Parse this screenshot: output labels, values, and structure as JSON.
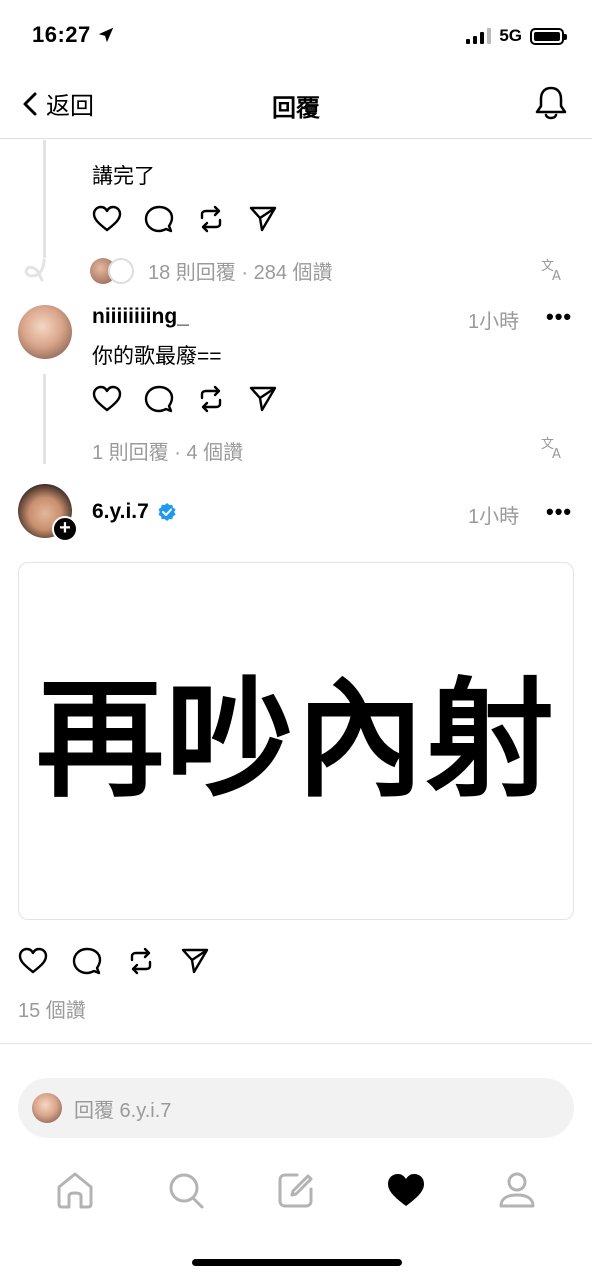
{
  "status_bar": {
    "time": "16:27",
    "network": "5G"
  },
  "header": {
    "back_label": "返回",
    "title": "回覆"
  },
  "parent_post": {
    "text": "講完了",
    "stats": "18 則回覆 · 284 個讚"
  },
  "reply": {
    "username": "niiiiiiiing_",
    "time": "1小時",
    "more": "•••",
    "text": "你的歌最廢==",
    "stats": "1 則回覆 · 4 個讚"
  },
  "main_post": {
    "username": "6.y.i.7",
    "time": "1小時",
    "more": "•••",
    "verified": true,
    "image_text": "再吵內射",
    "likes": "15 個讚"
  },
  "reply_input": {
    "placeholder": "回覆 6.y.i.7"
  },
  "tabbar": {
    "items": [
      "home-icon",
      "search-icon",
      "compose-icon",
      "heart-icon",
      "profile-icon"
    ],
    "active": "heart-icon"
  },
  "colors": {
    "muted": "#9a9a9a",
    "verified": "#1d9bf0",
    "divider": "#e3e3e3"
  }
}
